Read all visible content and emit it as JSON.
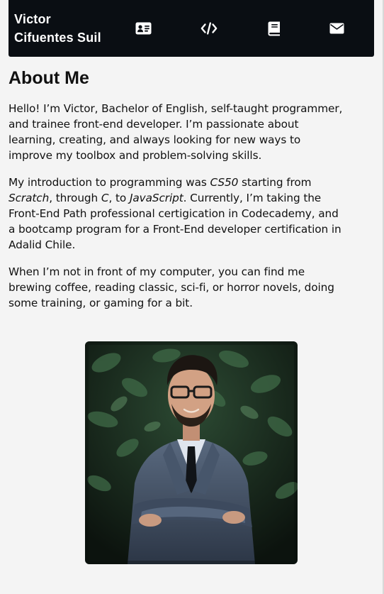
{
  "nav": {
    "brand_line1": "Victor",
    "brand_line2": "Cifuentes Suil",
    "links": [
      {
        "icon": "id-card-icon"
      },
      {
        "icon": "code-icon"
      },
      {
        "icon": "book-icon"
      },
      {
        "icon": "envelope-icon"
      }
    ],
    "background": "#0a0e13",
    "icon_color": "#ffffff"
  },
  "about": {
    "heading": "About Me",
    "p1": "Hello! I’m Victor, Bachelor of English, self-taught programmer, and trainee front-end developer. I’m passionate about learning, creating, and always looking for new ways to improve my toolbox and problem-solving skills.",
    "p2": {
      "t1": "My introduction to programming was ",
      "i1": "CS50",
      "t2": " starting from ",
      "i2": "Scratch",
      "t3": ", through ",
      "i3": "C",
      "t4": ", to ",
      "i4": "JavaScript",
      "t5": ". Currently, I’m taking the Front-End Path professional certigication in Codecademy, and a bootcamp program for a Front-End developer certification in Adalid Chile."
    },
    "p3": "When I’m not in front of my computer, you can find me brewing coffee, reading classic, sci-fi, or horror novels, doing some training, or gaming for a bit."
  },
  "photo": {
    "subject": "portrait-photo"
  },
  "colors": {
    "page_background": "#f4f4f4",
    "text": "#111111"
  }
}
